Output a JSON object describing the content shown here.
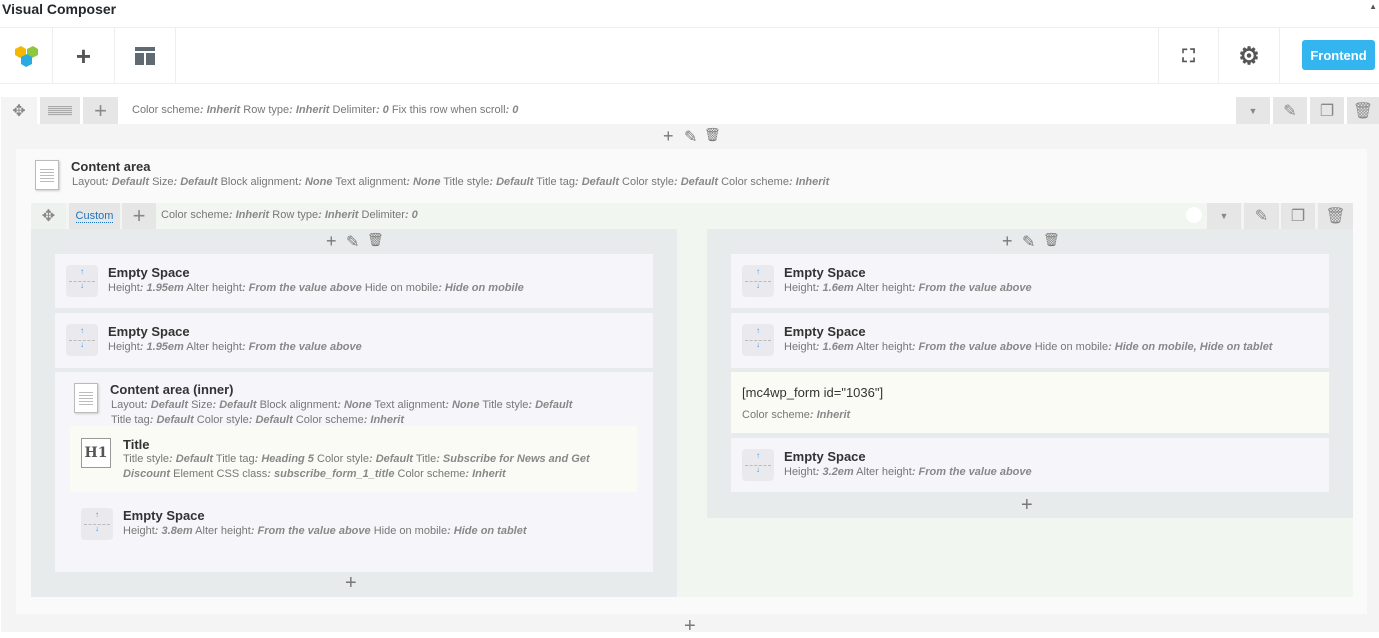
{
  "app": {
    "title": "Visual Composer",
    "frontend_label": "Frontend"
  },
  "outer_row": {
    "meta": [
      [
        "Color scheme",
        "Inherit"
      ],
      [
        "Row type",
        "Inherit"
      ],
      [
        "Delimiter",
        "0"
      ],
      [
        "Fix this row when scroll",
        "0"
      ]
    ]
  },
  "content_area": {
    "title": "Content area",
    "meta": [
      [
        "Layout",
        "Default"
      ],
      [
        "Size",
        "Default"
      ],
      [
        "Block alignment",
        "None"
      ],
      [
        "Text alignment",
        "None"
      ],
      [
        "Title style",
        "Default"
      ],
      [
        "Title tag",
        "Default"
      ],
      [
        "Color style",
        "Default"
      ],
      [
        "Color scheme",
        "Inherit"
      ]
    ]
  },
  "inner_row": {
    "layout_label": "Custom",
    "meta": [
      [
        "Color scheme",
        "Inherit"
      ],
      [
        "Row type",
        "Inherit"
      ],
      [
        "Delimiter",
        "0"
      ]
    ]
  },
  "left": {
    "es1": {
      "title": "Empty Space",
      "meta": [
        [
          "Height",
          "1.95em"
        ],
        [
          "Alter height",
          "From the value above"
        ],
        [
          "Hide on mobile",
          "Hide on mobile"
        ]
      ]
    },
    "es2": {
      "title": "Empty Space",
      "meta": [
        [
          "Height",
          "1.95em"
        ],
        [
          "Alter height",
          "From the value above"
        ]
      ]
    },
    "inner": {
      "title": "Content area (inner)",
      "meta": [
        [
          "Layout",
          "Default"
        ],
        [
          "Size",
          "Default"
        ],
        [
          "Block alignment",
          "None"
        ],
        [
          "Text alignment",
          "None"
        ],
        [
          "Title style",
          "Default"
        ],
        [
          "Title tag",
          "Default"
        ],
        [
          "Color style",
          "Default"
        ],
        [
          "Color scheme",
          "Inherit"
        ]
      ]
    },
    "heading": {
      "icon_text": "H1",
      "title": "Title",
      "meta": [
        [
          "Title style",
          "Default"
        ],
        [
          "Title tag",
          "Heading 5"
        ],
        [
          "Color style",
          "Default"
        ],
        [
          "Title",
          "Subscribe for News and Get Discount"
        ],
        [
          "Element CSS class",
          "subscribe_form_1_title"
        ],
        [
          "Color scheme",
          "Inherit"
        ]
      ]
    },
    "es3": {
      "title": "Empty Space",
      "meta": [
        [
          "Height",
          "3.8em"
        ],
        [
          "Alter height",
          "From the value above"
        ],
        [
          "Hide on mobile",
          "Hide on tablet"
        ]
      ]
    }
  },
  "right": {
    "es1": {
      "title": "Empty Space",
      "meta": [
        [
          "Height",
          "1.6em"
        ],
        [
          "Alter height",
          "From the value above"
        ]
      ]
    },
    "es2": {
      "title": "Empty Space",
      "meta": [
        [
          "Height",
          "1.6em"
        ],
        [
          "Alter height",
          "From the value above"
        ],
        [
          "Hide on mobile",
          "Hide on mobile, Hide on tablet"
        ]
      ]
    },
    "shortcode": {
      "text": "[mc4wp_form id=\"1036\"]",
      "meta": [
        [
          "Color scheme",
          "Inherit"
        ]
      ]
    },
    "es3": {
      "title": "Empty Space",
      "meta": [
        [
          "Height",
          "3.2em"
        ],
        [
          "Alter height",
          "From the value above"
        ]
      ]
    }
  }
}
